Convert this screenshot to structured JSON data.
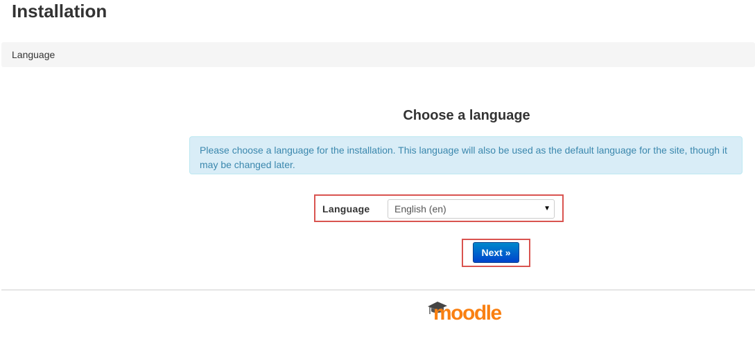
{
  "page": {
    "title": "Installation"
  },
  "breadcrumb": {
    "label": "Language"
  },
  "main": {
    "heading": "Choose a language",
    "info": "Please choose a language for the installation. This language will also be used as the default language for the site, though it may be changed later."
  },
  "form": {
    "language_label": "Language",
    "language_selected": "English (en)",
    "next_label": "Next »"
  },
  "footer": {
    "logo_text": "moodle",
    "logo_icon": "graduation-cap-icon"
  },
  "colors": {
    "highlight": "#d9534f",
    "info_bg": "#d9edf7",
    "info_text": "#3a87ad",
    "button": "#0055cc",
    "logo_orange": "#f98012"
  }
}
